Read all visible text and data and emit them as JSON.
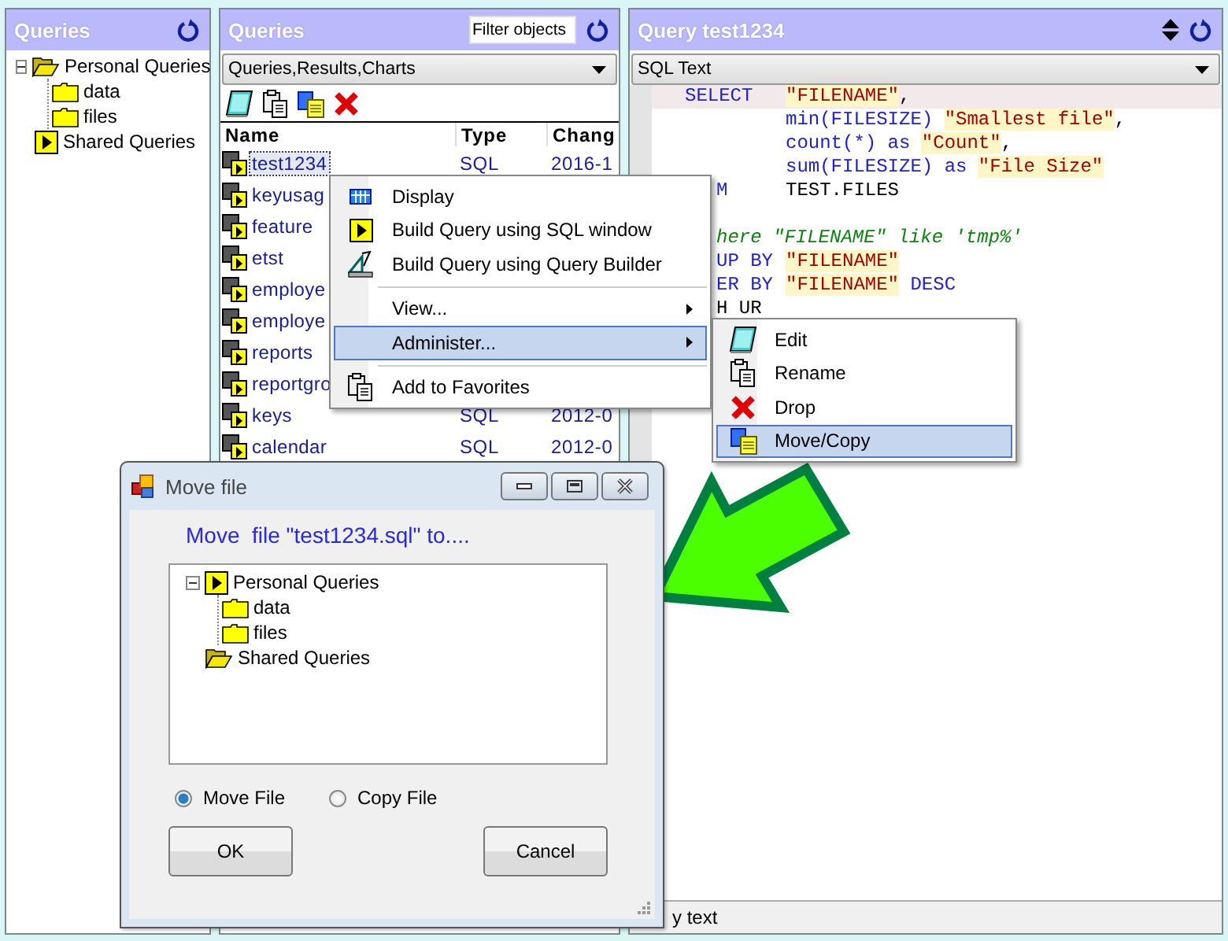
{
  "queries_panel": {
    "title": "Queries",
    "tree": [
      {
        "label": "Personal Queries",
        "kind": "open-folder",
        "expanded": true,
        "children": [
          {
            "label": "data",
            "kind": "folder"
          },
          {
            "label": "files",
            "kind": "folder"
          }
        ]
      },
      {
        "label": "Shared Queries",
        "kind": "play"
      }
    ]
  },
  "list_panel": {
    "title": "Queries",
    "filter": {
      "placeholder": "Filter objects"
    },
    "view_select": "Queries,Results,Charts",
    "columns": [
      "Name",
      "Type",
      "Chang"
    ],
    "rows": [
      {
        "name": "test1234",
        "type": "SQL",
        "changed": "2016-1",
        "selected": true
      },
      {
        "name": "keyusag",
        "selected": false
      },
      {
        "name": "feature",
        "selected": false
      },
      {
        "name": "etst",
        "selected": false
      },
      {
        "name": "employe",
        "selected": false
      },
      {
        "name": "employe",
        "selected": false
      },
      {
        "name": "reports",
        "selected": false
      },
      {
        "name": "reportgro",
        "selected": false
      },
      {
        "name": "keys",
        "type": "SQL",
        "changed": "2012-0",
        "selected": false
      },
      {
        "name": "calendar",
        "type": "SQL",
        "changed": "2012-0",
        "selected": false
      }
    ]
  },
  "query_panel": {
    "title": "Query test1234",
    "view_select": "SQL Text",
    "lines": [
      {
        "covered": false,
        "head": {
          "kind": "keyword",
          "text": "SELECT"
        },
        "tokens": [
          {
            "kind": "string",
            "text": "\"FILENAME\""
          },
          {
            "kind": "plain",
            "text": ","
          }
        ]
      },
      {
        "covered": false,
        "tokens": [
          {
            "kind": "keyword",
            "text": "min(FILESIZE) "
          },
          {
            "kind": "string",
            "text": "\"Smallest file\""
          },
          {
            "kind": "plain",
            "text": ","
          }
        ]
      },
      {
        "covered": false,
        "tokens": [
          {
            "kind": "keyword",
            "text": "count(*) as "
          },
          {
            "kind": "string",
            "text": "\"Count\""
          },
          {
            "kind": "plain",
            "text": ","
          }
        ]
      },
      {
        "covered": false,
        "tokens": [
          {
            "kind": "keyword",
            "text": "sum(FILESIZE) as "
          },
          {
            "kind": "string",
            "text": "\"File Size\""
          }
        ]
      },
      {
        "covered": true,
        "head": {
          "kind": "keyword",
          "text": "M"
        },
        "tokens": [
          {
            "kind": "plain",
            "text": "TEST.FILES"
          }
        ]
      },
      {
        "covered": true,
        "spaced": true,
        "head": {
          "kind": "comment",
          "text": "here \"FILENAME\" like 'tmp%'"
        }
      },
      {
        "covered": true,
        "head": {
          "kind": "keyword",
          "text": "UP BY"
        },
        "tokens": [
          {
            "kind": "string",
            "text": "\"FILENAME\""
          }
        ]
      },
      {
        "covered": true,
        "head": {
          "kind": "keyword",
          "text": "ER BY"
        },
        "tokens": [
          {
            "kind": "string",
            "text": "\"FILENAME\""
          },
          {
            "kind": "keyword",
            "text": " DESC"
          }
        ]
      },
      {
        "covered": true,
        "head": {
          "kind": "plain",
          "text": "H UR"
        }
      }
    ],
    "status_bar": "y text"
  },
  "context_menu": {
    "items": [
      {
        "kind": "item",
        "label": "Display",
        "submenu": false,
        "selected": false
      },
      {
        "kind": "item",
        "label": "Build Query using SQL window",
        "submenu": false,
        "selected": false
      },
      {
        "kind": "item",
        "label": "Build Query using Query Builder",
        "submenu": false,
        "selected": false
      },
      {
        "kind": "separator"
      },
      {
        "kind": "item",
        "label": "View...",
        "submenu": true,
        "selected": false
      },
      {
        "kind": "item",
        "label": "Administer...",
        "submenu": true,
        "selected": true
      },
      {
        "kind": "separator"
      },
      {
        "kind": "item",
        "label": "Add to Favorites",
        "submenu": false,
        "selected": false
      }
    ]
  },
  "submenu": {
    "items": [
      {
        "label": "Edit",
        "selected": false
      },
      {
        "label": "Rename",
        "selected": false
      },
      {
        "label": "Drop",
        "selected": false
      },
      {
        "label": "Move/Copy",
        "selected": true
      }
    ]
  },
  "dialog": {
    "title": "Move file",
    "prompt": "Move  file \"test1234.sql\" to....",
    "tree": [
      {
        "label": "Personal Queries",
        "kind": "play",
        "expanded": true,
        "children": [
          {
            "label": "data",
            "kind": "folder"
          },
          {
            "label": "files",
            "kind": "folder"
          }
        ]
      },
      {
        "label": "Shared Queries",
        "kind": "open-folder"
      }
    ],
    "options": [
      {
        "label": "Move File",
        "selected": true
      },
      {
        "label": "Copy File",
        "selected": false
      }
    ],
    "buttons": [
      "OK",
      "Cancel"
    ]
  }
}
